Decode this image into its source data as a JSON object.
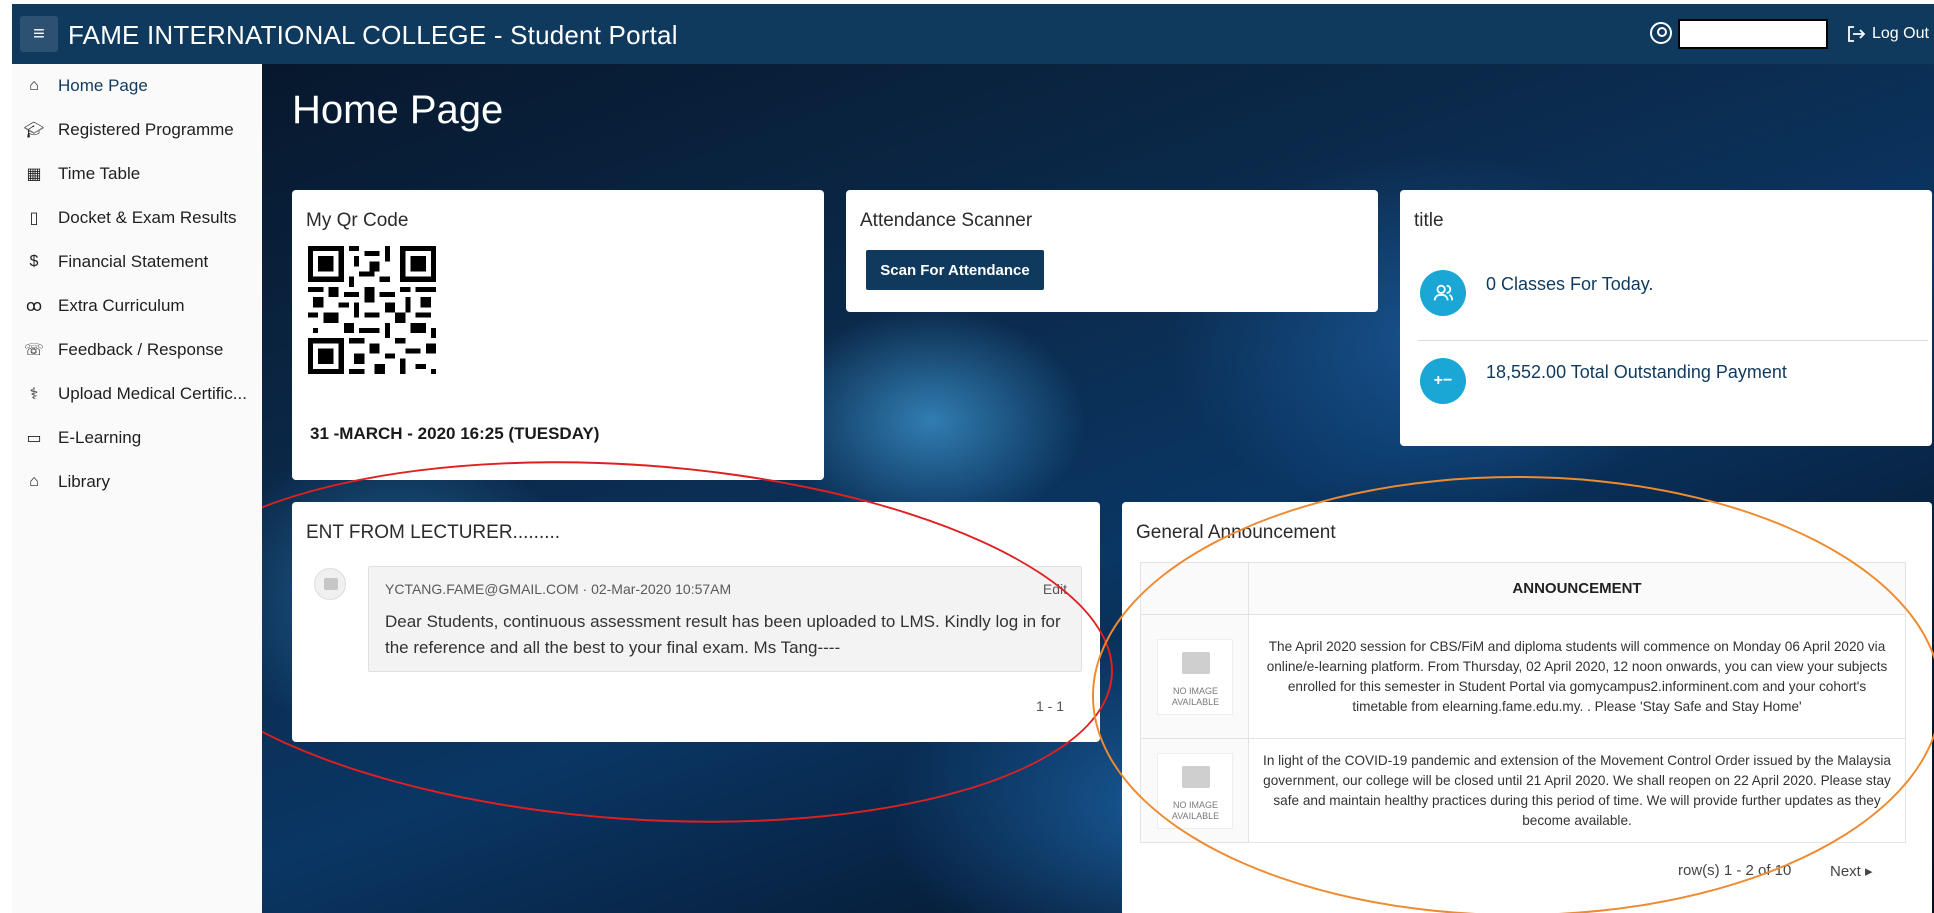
{
  "header": {
    "menu_icon": "hamburger-icon",
    "title": "FAME INTERNATIONAL COLLEGE - Student Portal",
    "user_icon": "user-circle-icon",
    "logout_label": "Log Out",
    "logout_icon": "logout-arrow-icon"
  },
  "sidebar": {
    "items": [
      {
        "label": "Home Page",
        "icon": "home-icon",
        "active": true
      },
      {
        "label": "Registered Programme",
        "icon": "graduate-icon"
      },
      {
        "label": "Time Table",
        "icon": "calendar-icon"
      },
      {
        "label": "Docket & Exam Results",
        "icon": "clipboard-icon"
      },
      {
        "label": "Financial Statement",
        "icon": "dollar-icon"
      },
      {
        "label": "Extra Curriculum",
        "icon": "bicycle-icon"
      },
      {
        "label": "Feedback / Response",
        "icon": "feedback-icon"
      },
      {
        "label": "Upload Medical Certific...",
        "icon": "stethoscope-icon"
      },
      {
        "label": "E-Learning",
        "icon": "book-icon"
      },
      {
        "label": "Library",
        "icon": "library-icon"
      }
    ]
  },
  "main": {
    "page_title": "Home Page",
    "qr_card": {
      "title": "My Qr Code",
      "datetime": "31 -MARCH - 2020 16:25 (TUESDAY)"
    },
    "attendance_card": {
      "title": "Attendance Scanner",
      "button_label": "Scan For Attendance"
    },
    "stats_card": {
      "title": "title",
      "classes_text": "0 Classes For Today.",
      "outstanding_text": "18,552.00 Total Outstanding Payment",
      "classes_icon": "people-icon",
      "payment_icon": "plus-minus-icon",
      "payment_glyph": "+−"
    },
    "comments_card": {
      "title": "ENT FROM LECTURER.........",
      "comment": {
        "meta": "YCTANG.FAME@GMAIL.COM · 02-Mar-2020 10:57AM",
        "edit_label": "Edit",
        "body": "Dear Students, continuous assessment result has been uploaded to LMS. Kindly log in for the reference and all the best to your final exam. Ms Tang----"
      },
      "pager": "1 - 1"
    },
    "announcement_card": {
      "title": "General Announcement",
      "column_header": "ANNOUNCEMENT",
      "no_image_text": "NO IMAGE AVAILABLE",
      "rows": [
        "The April 2020 session for CBS/FiM and diploma students will commence on Monday 06 April 2020 via online/e-learning platform. From Thursday, 02 April 2020, 12 noon onwards, you can view your subjects enrolled for this semester in Student Portal via gomycampus2.informinent.com and your cohort's timetable from elearning.fame.edu.my. . Please 'Stay Safe and Stay Home'",
        "In light of the COVID-19 pandemic and extension of the Movement Control Order issued by the Malaysia government, our college will be closed until 21 April 2020. We shall reopen on 22 April 2020. Please stay safe and maintain healthy practices during this period of time. We will provide further updates as they become available."
      ],
      "pager": "row(s) 1 - 2 of 10",
      "next_label": "Next ▸"
    }
  },
  "colors": {
    "header_bg": "#0f3a5e",
    "accent": "#1aa7d6",
    "annotation_red": "#e02020",
    "annotation_orange": "#ee8a30"
  }
}
